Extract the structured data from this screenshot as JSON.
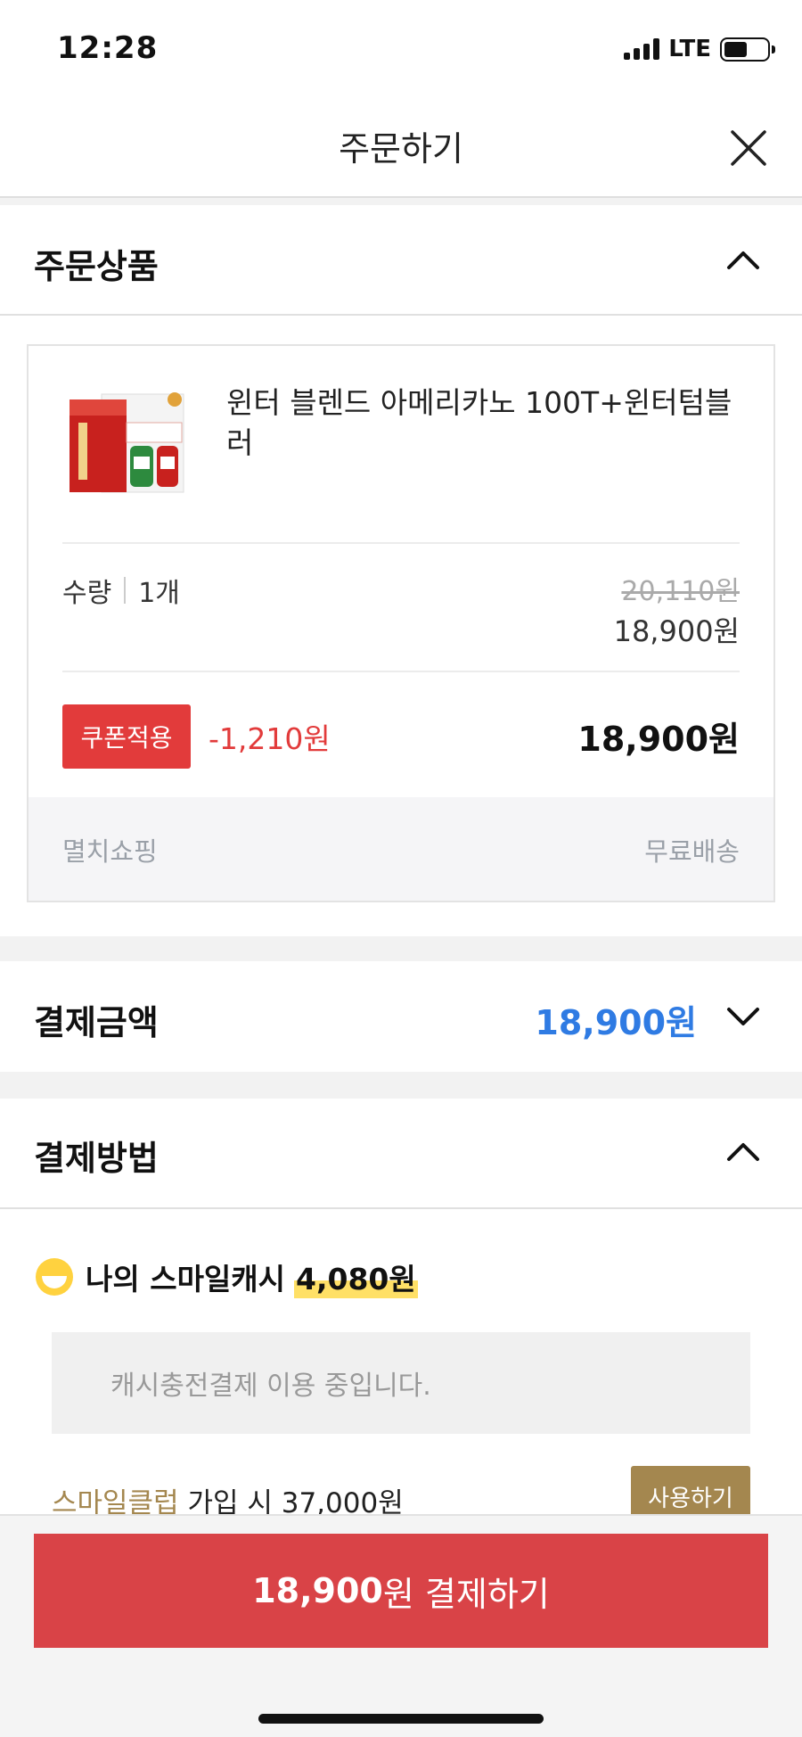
{
  "status_bar": {
    "time": "12:28",
    "network": "LTE",
    "battery_level": 0.55
  },
  "header": {
    "title": "주문하기",
    "close_icon": "close-icon"
  },
  "order_items": {
    "title": "주문상품",
    "product": {
      "name": "윈터 블렌드 아메리카노 100T+윈터텀블러",
      "quantity_label": "수량",
      "quantity": "1개",
      "original_price": "20,110원",
      "sale_price": "18,900원",
      "coupon_label": "쿠폰적용",
      "discount": "-1,210원",
      "final_price": "18,900원"
    },
    "seller": "멸치쇼핑",
    "shipping": "무료배송"
  },
  "payment_amount": {
    "title": "결제금액",
    "amount": "18,900원"
  },
  "payment_method": {
    "title": "결제방법",
    "smile_cash_label": "나의 스마일캐시",
    "smile_cash_amount": "4,080원",
    "notice": "캐시충전결제 이용 중입니다.",
    "club_name": "스마일클럽",
    "club_text": " 가입 시 37,000원",
    "use_button": "사용하기"
  },
  "footer": {
    "pay_amount": "18,900",
    "pay_suffix": "원 결제하기"
  },
  "colors": {
    "accent_red": "#d94347",
    "coupon_red": "#e23b3b",
    "amount_blue": "#2f7be3",
    "club_gold": "#a4874f",
    "cash_yellow": "#ffe066"
  }
}
